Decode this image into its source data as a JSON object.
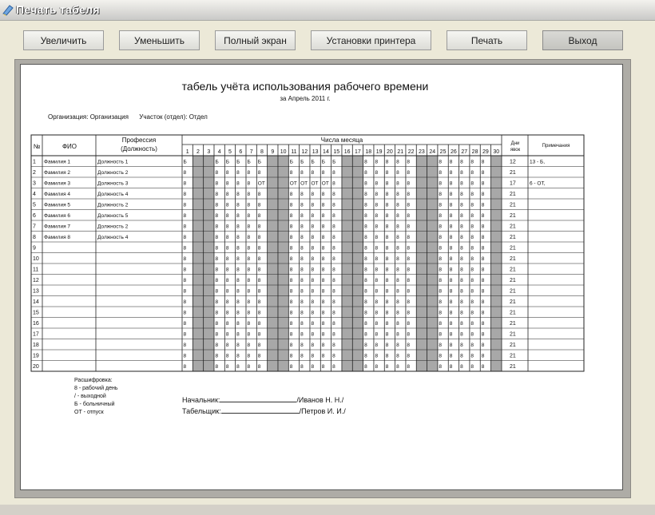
{
  "window": {
    "title": "Печать табеля",
    "icon": "app-icon"
  },
  "toolbar": {
    "zoom_in": "Увеличить",
    "zoom_out": "Уменьшить",
    "fullscreen": "Полный экран",
    "printer_setup": "Установки принтера",
    "print": "Печать",
    "exit": "Выход"
  },
  "document": {
    "title": "табель учёта использования рабочего времени",
    "subtitle": "за Апрель 2011 г.",
    "organization": "Организация: Организация",
    "department": "Участок (отдел): Отдел"
  },
  "table": {
    "headers": {
      "num": "№",
      "name": "ФИО",
      "profession": "Профессия (Должность)",
      "days_of_month": "Числа месяца",
      "work_days": "Дни явок",
      "notes": "Примечания"
    },
    "days": [
      "1",
      "2",
      "3",
      "4",
      "5",
      "6",
      "7",
      "8",
      "9",
      "10",
      "11",
      "12",
      "13",
      "14",
      "15",
      "16",
      "17",
      "18",
      "19",
      "20",
      "21",
      "22",
      "23",
      "24",
      "25",
      "26",
      "27",
      "28",
      "29",
      "30"
    ],
    "weekend_days": [
      2,
      3,
      9,
      10,
      16,
      17,
      23,
      24,
      30
    ],
    "rows": [
      {
        "n": "1",
        "name": "Фамилия 1",
        "prof": "Должность 1",
        "cells": [
          "Б",
          "",
          "",
          "Б",
          "Б",
          "Б",
          "Б",
          "Б",
          "",
          "",
          "Б",
          "Б",
          "Б",
          "Б",
          "Б",
          "",
          "",
          "8",
          "8",
          "8",
          "8",
          "8",
          "",
          "",
          "8",
          "8",
          "8",
          "8",
          "8",
          ""
        ],
        "days_worked": "12",
        "note": "13 - Б,"
      },
      {
        "n": "2",
        "name": "Фамилия 2",
        "prof": "Должность 2",
        "cells": [
          "8",
          "",
          "",
          "8",
          "8",
          "8",
          "8",
          "8",
          "",
          "",
          "8",
          "8",
          "8",
          "8",
          "8",
          "",
          "",
          "8",
          "8",
          "8",
          "8",
          "8",
          "",
          "",
          "8",
          "8",
          "8",
          "8",
          "8",
          ""
        ],
        "days_worked": "21",
        "note": ""
      },
      {
        "n": "3",
        "name": "Фамилия 3",
        "prof": "Должность 3",
        "cells": [
          "8",
          "",
          "",
          "8",
          "8",
          "8",
          "8",
          "ОТ",
          "",
          "",
          "ОТ",
          "ОТ",
          "ОТ",
          "ОТ",
          "8",
          "",
          "",
          "8",
          "8",
          "8",
          "8",
          "8",
          "",
          "",
          "8",
          "8",
          "8",
          "8",
          "8",
          ""
        ],
        "days_worked": "17",
        "note": "6 - ОТ,"
      },
      {
        "n": "4",
        "name": "Фамилия 4",
        "prof": "Должность 4",
        "cells": [
          "8",
          "",
          "",
          "8",
          "8",
          "8",
          "8",
          "8",
          "",
          "",
          "8",
          "8",
          "8",
          "8",
          "8",
          "",
          "",
          "8",
          "8",
          "8",
          "8",
          "8",
          "",
          "",
          "8",
          "8",
          "8",
          "8",
          "8",
          ""
        ],
        "days_worked": "21",
        "note": ""
      },
      {
        "n": "5",
        "name": "Фамилия 5",
        "prof": "Должность 2",
        "cells": [
          "8",
          "",
          "",
          "8",
          "8",
          "8",
          "8",
          "8",
          "",
          "",
          "8",
          "8",
          "8",
          "8",
          "8",
          "",
          "",
          "8",
          "8",
          "8",
          "8",
          "8",
          "",
          "",
          "8",
          "8",
          "8",
          "8",
          "8",
          ""
        ],
        "days_worked": "21",
        "note": ""
      },
      {
        "n": "6",
        "name": "Фамилия 6",
        "prof": "Должность 5",
        "cells": [
          "8",
          "",
          "",
          "8",
          "8",
          "8",
          "8",
          "8",
          "",
          "",
          "8",
          "8",
          "8",
          "8",
          "8",
          "",
          "",
          "8",
          "8",
          "8",
          "8",
          "8",
          "",
          "",
          "8",
          "8",
          "8",
          "8",
          "8",
          ""
        ],
        "days_worked": "21",
        "note": ""
      },
      {
        "n": "7",
        "name": "Фамилия 7",
        "prof": "Должность 2",
        "cells": [
          "8",
          "",
          "",
          "8",
          "8",
          "8",
          "8",
          "8",
          "",
          "",
          "8",
          "8",
          "8",
          "8",
          "8",
          "",
          "",
          "8",
          "8",
          "8",
          "8",
          "8",
          "",
          "",
          "8",
          "8",
          "8",
          "8",
          "8",
          ""
        ],
        "days_worked": "21",
        "note": ""
      },
      {
        "n": "8",
        "name": "Фамилия 8",
        "prof": "Должность 4",
        "cells": [
          "8",
          "",
          "",
          "8",
          "8",
          "8",
          "8",
          "8",
          "",
          "",
          "8",
          "8",
          "8",
          "8",
          "8",
          "",
          "",
          "8",
          "8",
          "8",
          "8",
          "8",
          "",
          "",
          "8",
          "8",
          "8",
          "8",
          "8",
          ""
        ],
        "days_worked": "21",
        "note": ""
      },
      {
        "n": "9",
        "name": "",
        "prof": "",
        "cells": [
          "8",
          "",
          "",
          "8",
          "8",
          "8",
          "8",
          "8",
          "",
          "",
          "8",
          "8",
          "8",
          "8",
          "8",
          "",
          "",
          "8",
          "8",
          "8",
          "8",
          "8",
          "",
          "",
          "8",
          "8",
          "8",
          "8",
          "8",
          ""
        ],
        "days_worked": "21",
        "note": ""
      },
      {
        "n": "10",
        "name": "",
        "prof": "",
        "cells": [
          "8",
          "",
          "",
          "8",
          "8",
          "8",
          "8",
          "8",
          "",
          "",
          "8",
          "8",
          "8",
          "8",
          "8",
          "",
          "",
          "8",
          "8",
          "8",
          "8",
          "8",
          "",
          "",
          "8",
          "8",
          "8",
          "8",
          "8",
          ""
        ],
        "days_worked": "21",
        "note": ""
      },
      {
        "n": "11",
        "name": "",
        "prof": "",
        "cells": [
          "8",
          "",
          "",
          "8",
          "8",
          "8",
          "8",
          "8",
          "",
          "",
          "8",
          "8",
          "8",
          "8",
          "8",
          "",
          "",
          "8",
          "8",
          "8",
          "8",
          "8",
          "",
          "",
          "8",
          "8",
          "8",
          "8",
          "8",
          ""
        ],
        "days_worked": "21",
        "note": ""
      },
      {
        "n": "12",
        "name": "",
        "prof": "",
        "cells": [
          "8",
          "",
          "",
          "8",
          "8",
          "8",
          "8",
          "8",
          "",
          "",
          "8",
          "8",
          "8",
          "8",
          "8",
          "",
          "",
          "8",
          "8",
          "8",
          "8",
          "8",
          "",
          "",
          "8",
          "8",
          "8",
          "8",
          "8",
          ""
        ],
        "days_worked": "21",
        "note": ""
      },
      {
        "n": "13",
        "name": "",
        "prof": "",
        "cells": [
          "8",
          "",
          "",
          "8",
          "8",
          "8",
          "8",
          "8",
          "",
          "",
          "8",
          "8",
          "8",
          "8",
          "8",
          "",
          "",
          "8",
          "8",
          "8",
          "8",
          "8",
          "",
          "",
          "8",
          "8",
          "8",
          "8",
          "8",
          ""
        ],
        "days_worked": "21",
        "note": ""
      },
      {
        "n": "14",
        "name": "",
        "prof": "",
        "cells": [
          "8",
          "",
          "",
          "8",
          "8",
          "8",
          "8",
          "8",
          "",
          "",
          "8",
          "8",
          "8",
          "8",
          "8",
          "",
          "",
          "8",
          "8",
          "8",
          "8",
          "8",
          "",
          "",
          "8",
          "8",
          "8",
          "8",
          "8",
          ""
        ],
        "days_worked": "21",
        "note": ""
      },
      {
        "n": "15",
        "name": "",
        "prof": "",
        "cells": [
          "8",
          "",
          "",
          "8",
          "8",
          "8",
          "8",
          "8",
          "",
          "",
          "8",
          "8",
          "8",
          "8",
          "8",
          "",
          "",
          "8",
          "8",
          "8",
          "8",
          "8",
          "",
          "",
          "8",
          "8",
          "8",
          "8",
          "8",
          ""
        ],
        "days_worked": "21",
        "note": ""
      },
      {
        "n": "16",
        "name": "",
        "prof": "",
        "cells": [
          "8",
          "",
          "",
          "8",
          "8",
          "8",
          "8",
          "8",
          "",
          "",
          "8",
          "8",
          "8",
          "8",
          "8",
          "",
          "",
          "8",
          "8",
          "8",
          "8",
          "8",
          "",
          "",
          "8",
          "8",
          "8",
          "8",
          "8",
          ""
        ],
        "days_worked": "21",
        "note": ""
      },
      {
        "n": "17",
        "name": "",
        "prof": "",
        "cells": [
          "8",
          "",
          "",
          "8",
          "8",
          "8",
          "8",
          "8",
          "",
          "",
          "8",
          "8",
          "8",
          "8",
          "8",
          "",
          "",
          "8",
          "8",
          "8",
          "8",
          "8",
          "",
          "",
          "8",
          "8",
          "8",
          "8",
          "8",
          ""
        ],
        "days_worked": "21",
        "note": ""
      },
      {
        "n": "18",
        "name": "",
        "prof": "",
        "cells": [
          "8",
          "",
          "",
          "8",
          "8",
          "8",
          "8",
          "8",
          "",
          "",
          "8",
          "8",
          "8",
          "8",
          "8",
          "",
          "",
          "8",
          "8",
          "8",
          "8",
          "8",
          "",
          "",
          "8",
          "8",
          "8",
          "8",
          "8",
          ""
        ],
        "days_worked": "21",
        "note": ""
      },
      {
        "n": "19",
        "name": "",
        "prof": "",
        "cells": [
          "8",
          "",
          "",
          "8",
          "8",
          "8",
          "8",
          "8",
          "",
          "",
          "8",
          "8",
          "8",
          "8",
          "8",
          "",
          "",
          "8",
          "8",
          "8",
          "8",
          "8",
          "",
          "",
          "8",
          "8",
          "8",
          "8",
          "8",
          ""
        ],
        "days_worked": "21",
        "note": ""
      },
      {
        "n": "20",
        "name": "",
        "prof": "",
        "cells": [
          "8",
          "",
          "",
          "8",
          "8",
          "8",
          "8",
          "8",
          "",
          "",
          "8",
          "8",
          "8",
          "8",
          "8",
          "",
          "",
          "8",
          "8",
          "8",
          "8",
          "8",
          "",
          "",
          "8",
          "8",
          "8",
          "8",
          "8",
          ""
        ],
        "days_worked": "21",
        "note": ""
      }
    ]
  },
  "legend": {
    "title": "Расшифровка:",
    "items": [
      "8 - рабочий день",
      "/ - выходной",
      "Б - больничный",
      "ОТ - отпуск"
    ]
  },
  "signatures": {
    "chief_label": "Начальник:",
    "chief_name": "/Иванов Н. Н./",
    "timekeeper_label": "Табельщик:",
    "timekeeper_name": "/Петров И. И./"
  },
  "colors": {
    "weekend_fill": "#a8a8a8",
    "title_text": "#ffffff"
  }
}
